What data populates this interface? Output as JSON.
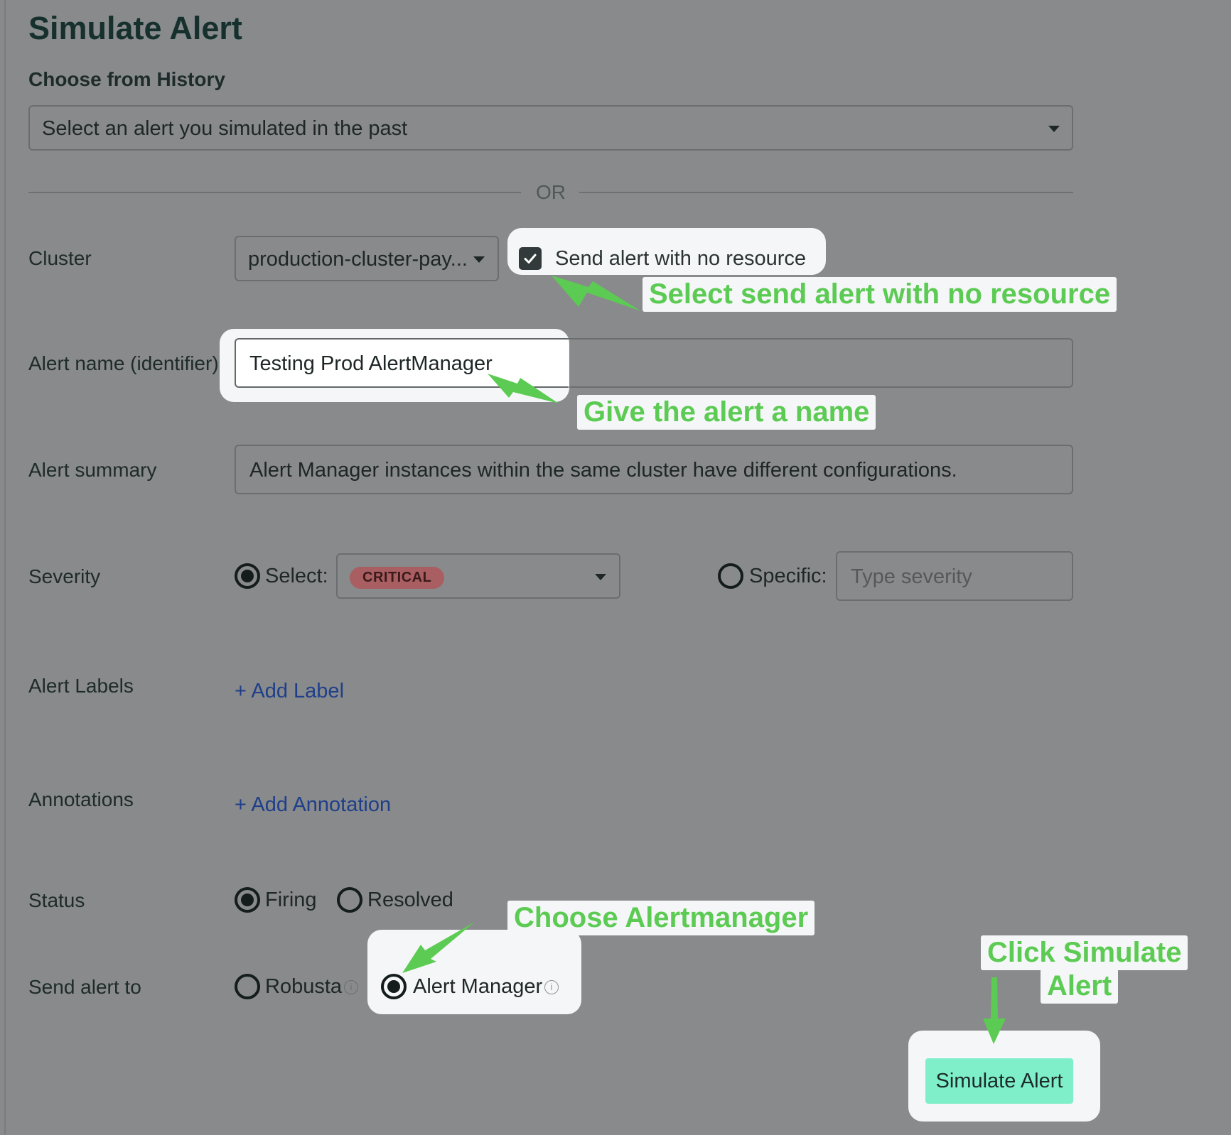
{
  "page": {
    "title": "Simulate Alert",
    "history_label": "Choose from History",
    "history_placeholder": "Select an alert you simulated in the past",
    "divider_text": "OR"
  },
  "form": {
    "cluster": {
      "label": "Cluster",
      "value": "production-cluster-pay..."
    },
    "no_resource_checkbox": {
      "label": "Send alert with no resource",
      "checked": true
    },
    "alert_name": {
      "label": "Alert name (identifier)",
      "value": "Testing Prod AlertManager"
    },
    "alert_summary": {
      "label": "Alert summary",
      "value": "Alert Manager instances within the same cluster have different configurations."
    },
    "severity": {
      "label": "Severity",
      "select_option_label": "Select:",
      "selected_value": "CRITICAL",
      "specific_option_label": "Specific:",
      "specific_placeholder": "Type severity",
      "mode": "select"
    },
    "alert_labels": {
      "label": "Alert Labels",
      "add_link": "+ Add Label"
    },
    "annotations": {
      "label": "Annotations",
      "add_link": "+ Add Annotation"
    },
    "status": {
      "label": "Status",
      "options": [
        "Firing",
        "Resolved"
      ],
      "selected": "Firing"
    },
    "send_to": {
      "label": "Send alert to",
      "options": [
        "Robusta",
        "Alert Manager"
      ],
      "selected": "Alert Manager"
    },
    "submit_button": "Simulate Alert"
  },
  "callouts": {
    "no_resource": "Select send alert with no resource",
    "name": "Give the alert a name",
    "alertmanager": "Choose Alertmanager",
    "simulate_line1": "Click Simulate",
    "simulate_line2": "Alert"
  },
  "colors": {
    "overlay_bg": "#888a8b",
    "callout_text": "#5ccb53",
    "callout_bg": "#f5f6f7",
    "button_bg": "#7eefc9",
    "badge_bg": "#a95e61",
    "badge_text": "#3a1a1a",
    "link": "#1f3f8a"
  },
  "icons": {
    "checkbox": "checkmark-icon",
    "dropdown": "caret-down-icon",
    "info": "info-circle-icon",
    "arrow": "callout-arrow-icon"
  }
}
